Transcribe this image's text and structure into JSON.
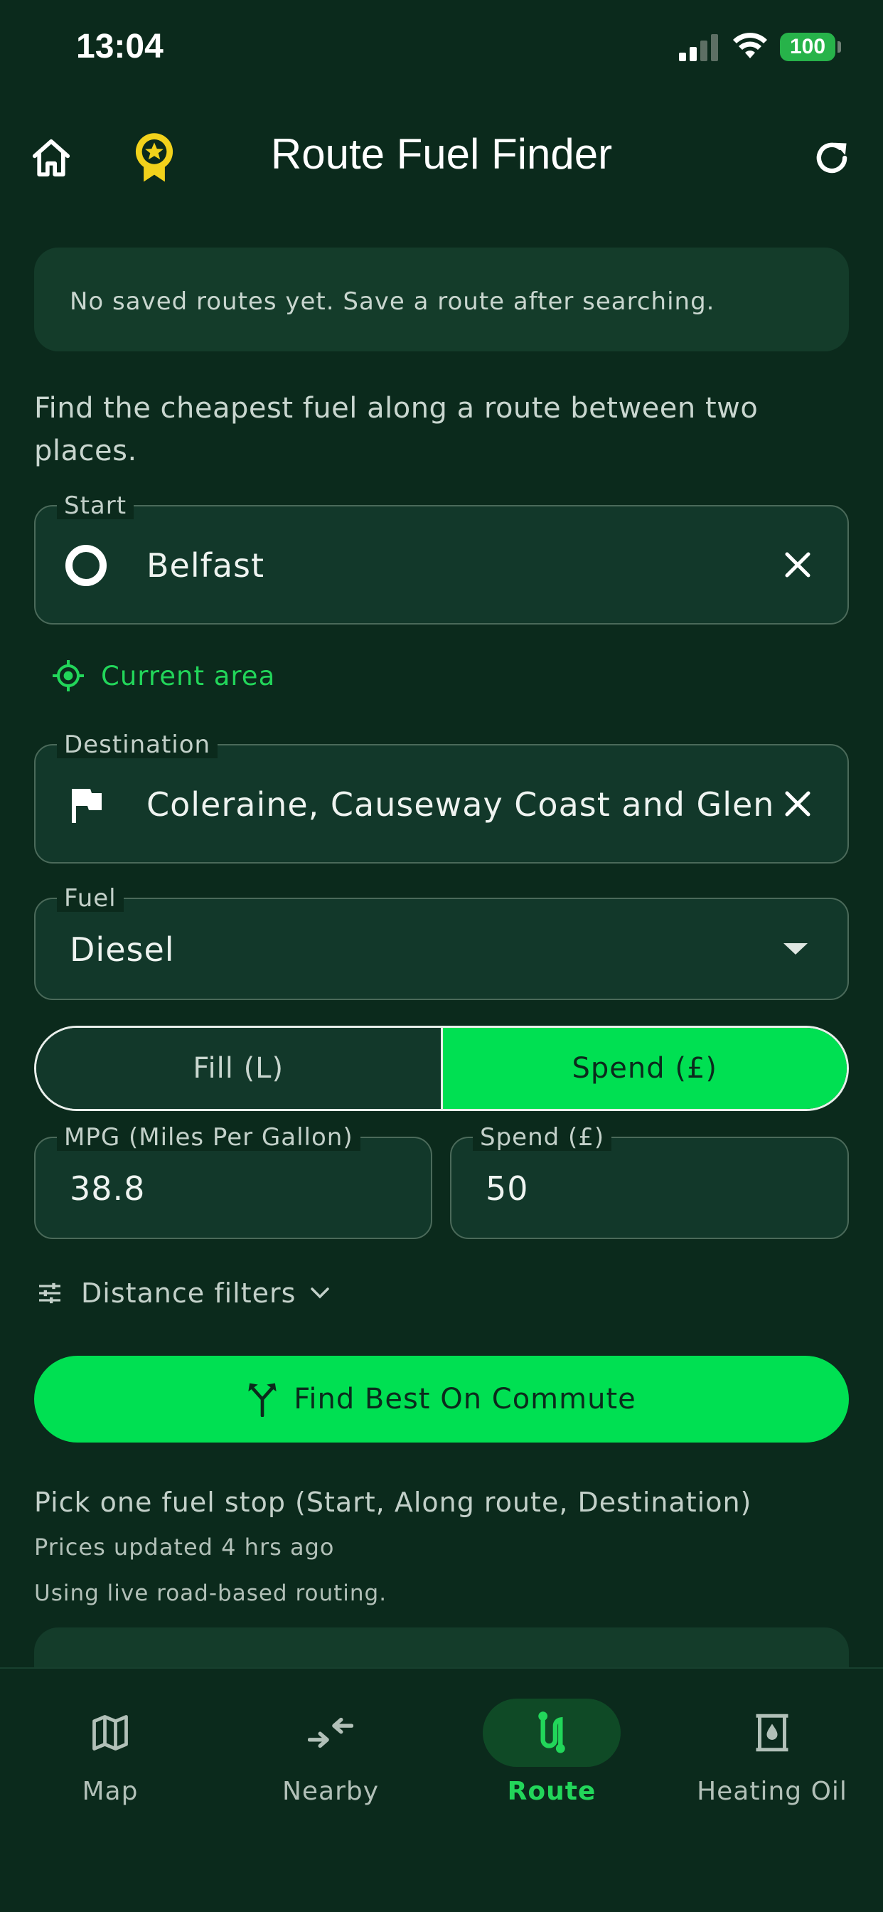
{
  "status_bar": {
    "time": "13:04",
    "battery": "100"
  },
  "app_bar": {
    "title": "Route Fuel Finder"
  },
  "saved_routes": {
    "empty_message": "No saved routes yet. Save a route after searching."
  },
  "intro": "Find the cheapest fuel along a route between two places.",
  "start": {
    "label": "Start",
    "value": "Belfast"
  },
  "current_area": "Current area",
  "destination": {
    "label": "Destination",
    "value": "Coleraine, Causeway Coast and Glens"
  },
  "fuel": {
    "label": "Fuel",
    "value": "Diesel"
  },
  "mode": {
    "fill_label": "Fill (L)",
    "spend_label": "Spend (£)",
    "selected": "Spend (£)"
  },
  "mpg": {
    "label": "MPG (Miles Per Gallon)",
    "value": "38.8"
  },
  "spend": {
    "label": "Spend (£)",
    "value": "50"
  },
  "filters": {
    "label": "Distance filters"
  },
  "find_button": {
    "label": "Find Best On Commute"
  },
  "results": {
    "pick": "Pick one fuel stop (Start, Along route, Destination)",
    "updated": "Prices updated 4 hrs ago",
    "routing": "Using live road-based routing."
  },
  "bottom_nav": {
    "items": [
      {
        "label": "Map",
        "icon": "map-icon"
      },
      {
        "label": "Nearby",
        "icon": "nearby-icon"
      },
      {
        "label": "Route",
        "icon": "route-icon",
        "active": true
      },
      {
        "label": "Heating Oil",
        "icon": "heating-oil-icon"
      }
    ]
  },
  "colors": {
    "background": "#0b2a1c",
    "accent": "#00e052",
    "card": "#143c2a",
    "badge": "#f2d21b"
  }
}
